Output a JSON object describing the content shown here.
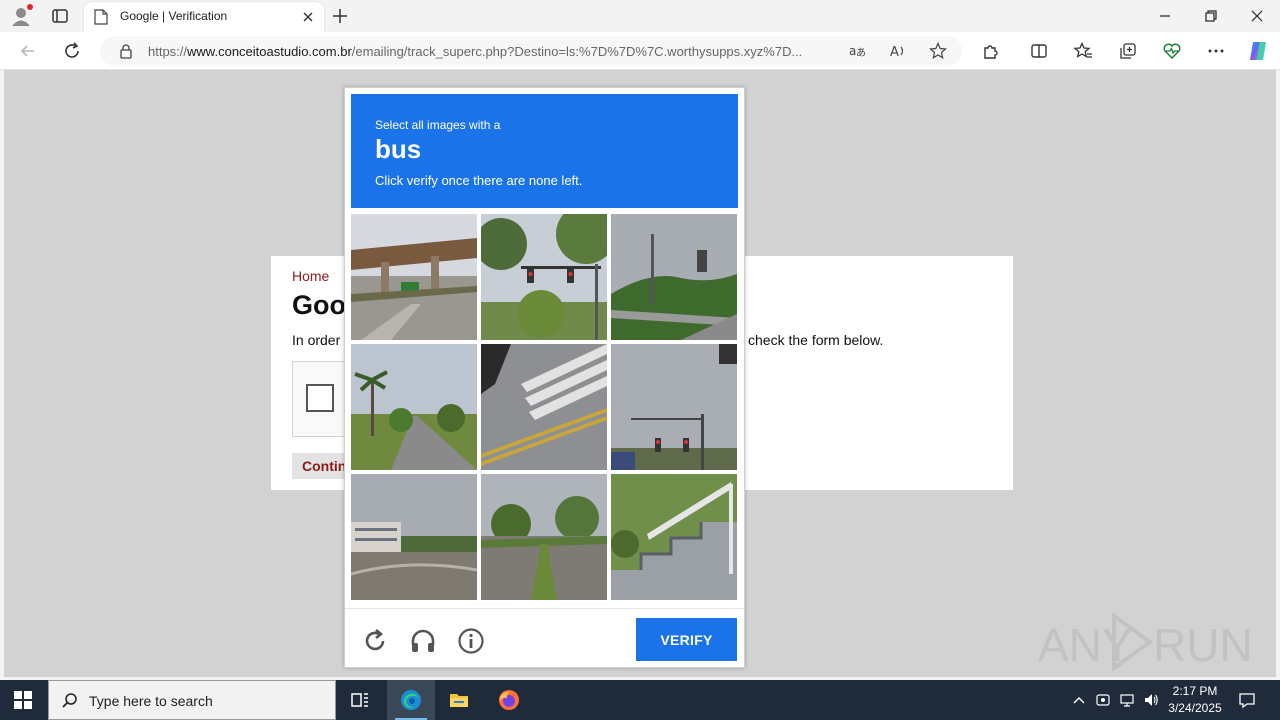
{
  "browser": {
    "tab_title": "Google | Verification",
    "url_prefix": "https://",
    "url_host": "www.conceitoastudio.com.br",
    "url_path": "/emailing/track_superc.php?Destino=ls:%7D%7D%7C.worthysupps.xyz%7D...",
    "icons": {
      "profile": "profile-icon",
      "tab_actions": "tab-actions-icon",
      "favicon": "page-icon",
      "close": "close-icon",
      "new_tab": "plus-icon",
      "back": "back-arrow-icon",
      "refresh": "refresh-icon",
      "lock": "lock-icon",
      "translate": "translate-icon",
      "read_aloud": "read-aloud-icon",
      "favorite": "star-icon",
      "extensions": "puzzle-icon",
      "split_screen": "split-screen-icon",
      "favorites": "favorites-icon",
      "collections": "collections-icon",
      "performance": "heart-pulse-icon",
      "more": "more-icon",
      "copilot": "copilot-icon"
    }
  },
  "page": {
    "home_link": "Home",
    "heading": "Goo",
    "instruction_start": "In order",
    "instruction_end": "check the form below.",
    "continue_label": "Contin"
  },
  "captcha": {
    "line1": "Select all images with a",
    "object": "bus",
    "line3": "Click verify once there are none left.",
    "verify_label": "VERIFY",
    "header_color": "#1a73e8",
    "tiles": [
      {
        "scene": "highway-overpass"
      },
      {
        "scene": "traffic-light-trees"
      },
      {
        "scene": "bridge-hills"
      },
      {
        "scene": "palm-tree-road"
      },
      {
        "scene": "crosswalk"
      },
      {
        "scene": "traffic-light-sky"
      },
      {
        "scene": "building-parking"
      },
      {
        "scene": "trees-road"
      },
      {
        "scene": "stairs-railing"
      }
    ],
    "icons": [
      "refresh-icon",
      "headphones-icon",
      "info-icon"
    ]
  },
  "watermark": {
    "left": "ANY",
    "right": "RUN"
  },
  "taskbar": {
    "search_placeholder": "Type here to search",
    "time": "2:17 PM",
    "date": "3/24/2025",
    "apps": [
      "task-view-icon",
      "edge-icon",
      "file-explorer-icon",
      "firefox-icon"
    ]
  }
}
